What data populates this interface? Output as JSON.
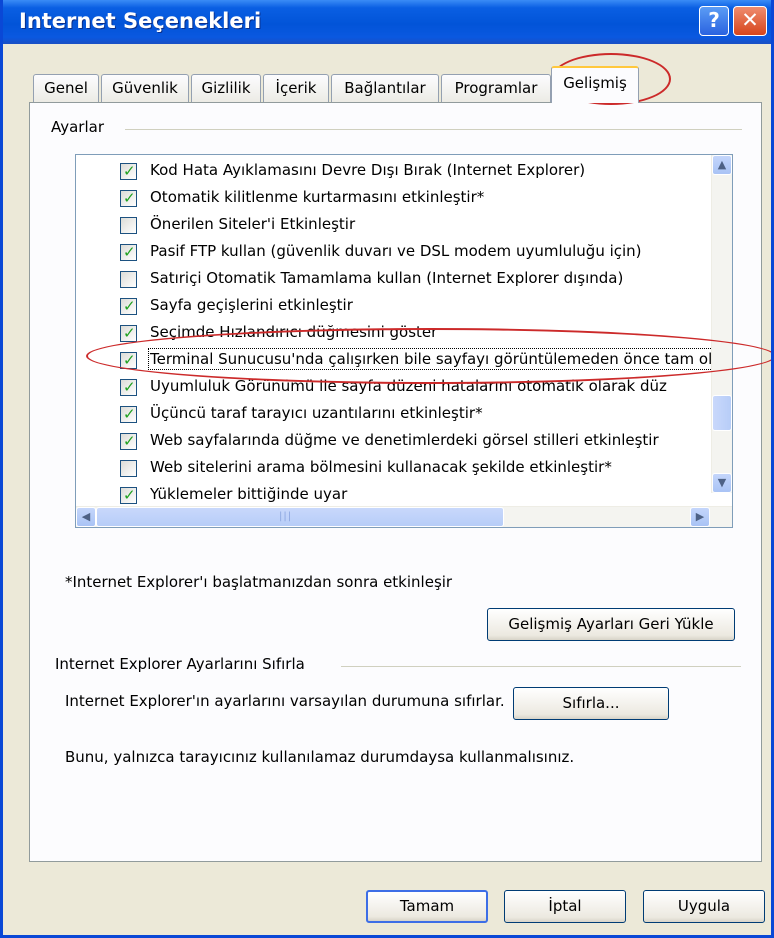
{
  "window": {
    "title": "Internet Seçenekleri",
    "help_glyph": "?",
    "close_glyph": "✕"
  },
  "tabs": [
    "Genel",
    "Güvenlik",
    "Gizlilik",
    "İçerik",
    "Bağlantılar",
    "Programlar",
    "Gelişmiş"
  ],
  "active_tab": "Gelişmiş",
  "settings": {
    "group_label": "Ayarlar",
    "items": [
      {
        "label": "Kod Hata Ayıklamasını Devre Dışı Bırak (Internet Explorer)",
        "checked": true
      },
      {
        "label": "Otomatik kilitlenme kurtarmasını etkinleştir*",
        "checked": true
      },
      {
        "label": "Önerilen Siteler'i Etkinleştir",
        "checked": false
      },
      {
        "label": "Pasif FTP kullan (güvenlik duvarı ve DSL modem uyumluluğu için)",
        "checked": true
      },
      {
        "label": "Satıriçi Otomatik Tamamlama kullan (Internet Explorer dışında)",
        "checked": false
      },
      {
        "label": "Sayfa geçişlerini etkinleştir",
        "checked": true
      },
      {
        "label": "Seçimde Hızlandırıcı düğmesini göster",
        "checked": true
      },
      {
        "label": "Terminal Sunucusu'nda çalışırken bile sayfayı görüntülemeden önce tam olarak",
        "checked": true
      },
      {
        "label": "Uyumluluk Görünümü ile sayfa düzeni hatalarını otomatik olarak düz",
        "checked": true
      },
      {
        "label": "Üçüncü taraf tarayıcı uzantılarını etkinleştir*",
        "checked": true
      },
      {
        "label": "Web sayfalarında düğme ve denetimlerdeki görsel stilleri etkinleştir",
        "checked": true
      },
      {
        "label": "Web sitelerini arama bölmesini kullanacak şekilde etkinleştir*",
        "checked": false
      },
      {
        "label": "Yüklemeler bittiğinde uyar",
        "checked": true
      }
    ]
  },
  "scroll_glyphs": {
    "up": "▲",
    "down": "▼",
    "left": "◀",
    "right": "▶",
    "grip": "|||"
  },
  "restart_note": "*Internet Explorer'ı başlatmanızdan sonra etkinleşir",
  "restore_button": "Gelişmiş Ayarları Geri Yükle",
  "reset_group": {
    "title": "Internet Explorer Ayarlarını Sıfırla",
    "description": "Internet Explorer'ın ayarlarını varsayılan durumuna sıfırlar.",
    "button": "Sıfırla...",
    "warning": "Bunu, yalnızca tarayıcınız kullanılamaz durumdaysa kullanmalısınız."
  },
  "footer": {
    "ok": "Tamam",
    "cancel": "İptal",
    "apply": "Uygula"
  },
  "colors": {
    "titlebar": "#0254d8",
    "dialog_bg": "#ece9d8",
    "annotation": "#cc2a2a",
    "check": "#21a121"
  }
}
